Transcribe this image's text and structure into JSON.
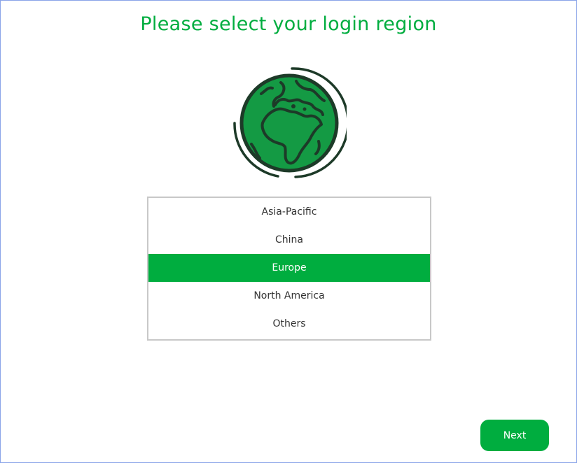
{
  "header": {
    "title": "Please select your login region"
  },
  "globe": {
    "icon": "globe-icon",
    "fill_color": "#149a44",
    "outline_color": "#1d3a28"
  },
  "region_list": {
    "selected": "Europe",
    "items": [
      {
        "label": "Asia-Pacific"
      },
      {
        "label": "China"
      },
      {
        "label": "Europe"
      },
      {
        "label": "North America"
      },
      {
        "label": "Others"
      }
    ]
  },
  "footer": {
    "next_label": "Next"
  },
  "colors": {
    "accent": "#00ad3f",
    "frame_border": "#8aa4e8",
    "list_border": "#c8c8c8"
  }
}
